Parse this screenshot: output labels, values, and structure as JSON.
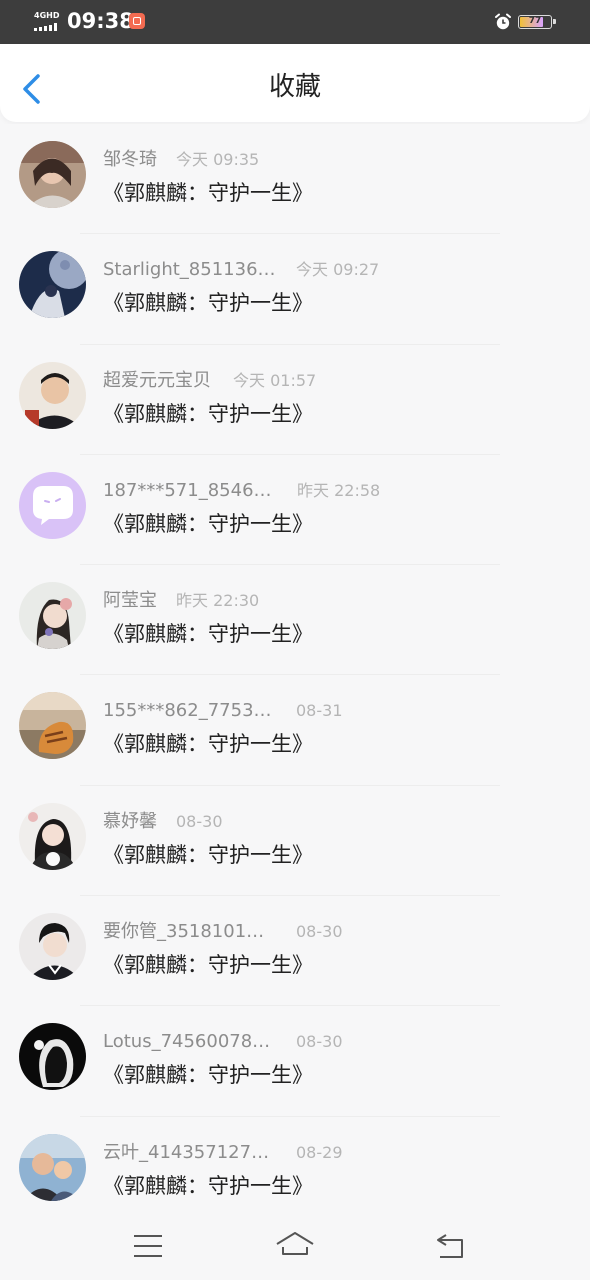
{
  "status_bar": {
    "network": "4GHD",
    "time": "09:38",
    "battery": "77",
    "battery_level": 0.77,
    "icons": [
      "signal-icon",
      "app-notification-icon",
      "alarm-icon",
      "battery-icon"
    ]
  },
  "header": {
    "title": "收藏",
    "back_icon": "chevron-left-icon",
    "accent_color": "#2e8de6"
  },
  "favorites": [
    {
      "name": "邹冬琦",
      "time": "今天 09:35",
      "content": "《郭麒麟：守护一生》",
      "avatar": "photo"
    },
    {
      "name": "Starlight_851136…",
      "time": "今天 09:27",
      "content": "《郭麒麟：守护一生》",
      "avatar": "photo"
    },
    {
      "name": "超爱元元宝贝",
      "time": "今天 01:57",
      "content": "《郭麒麟：守护一生》",
      "avatar": "photo"
    },
    {
      "name": "187***571_8546…",
      "time": "昨天 22:58",
      "content": "《郭麒麟：守护一生》",
      "avatar": "default-chat-bubble"
    },
    {
      "name": "阿莹宝",
      "time": "昨天 22:30",
      "content": "《郭麒麟：守护一生》",
      "avatar": "photo"
    },
    {
      "name": "155***862_7753…",
      "time": "08-31",
      "content": "《郭麒麟：守护一生》",
      "avatar": "photo"
    },
    {
      "name": "慕妤馨",
      "time": "08-30",
      "content": "《郭麒麟：守护一生》",
      "avatar": "photo"
    },
    {
      "name": "要你管_3518101…",
      "time": "08-30",
      "content": "《郭麒麟：守护一生》",
      "avatar": "photo"
    },
    {
      "name": "Lotus_74560078…",
      "time": "08-30",
      "content": "《郭麒麟：守护一生》",
      "avatar": "photo"
    },
    {
      "name": "云叶_414357127…",
      "time": "08-29",
      "content": "《郭麒麟：守护一生》",
      "avatar": "photo"
    }
  ],
  "nav_bar": {
    "buttons": [
      "menu-icon",
      "home-icon",
      "back-icon"
    ]
  }
}
